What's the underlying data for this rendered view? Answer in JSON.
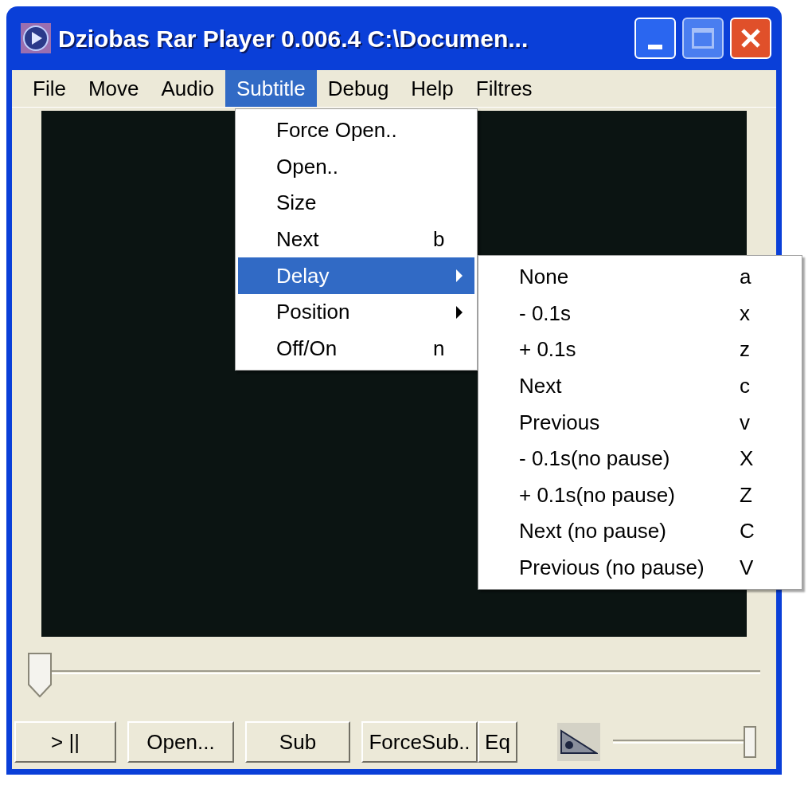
{
  "window": {
    "title": "Dziobas Rar Player 0.006.4 C:\\Documen..."
  },
  "menu_bar": [
    {
      "label": "File",
      "selected": false
    },
    {
      "label": "Move",
      "selected": false
    },
    {
      "label": "Audio",
      "selected": false
    },
    {
      "label": "Subtitle",
      "selected": true
    },
    {
      "label": "Debug",
      "selected": false
    },
    {
      "label": "Help",
      "selected": false
    },
    {
      "label": "Filtres",
      "selected": false
    }
  ],
  "subtitle_menu": [
    {
      "label": "Force Open..",
      "submenu": false,
      "selected": false
    },
    {
      "label": "Open..",
      "submenu": false,
      "selected": false
    },
    {
      "label": "Size",
      "submenu": false,
      "selected": false
    },
    {
      "label": "Next",
      "shortcut": "b",
      "submenu": false,
      "selected": false
    },
    {
      "label": "Delay",
      "submenu": true,
      "selected": true
    },
    {
      "label": "Position",
      "submenu": true,
      "selected": false
    },
    {
      "label": "Off/On",
      "shortcut": "n",
      "submenu": false,
      "selected": false
    }
  ],
  "delay_submenu": [
    {
      "label": "None",
      "shortcut": "a",
      "selected": false
    },
    {
      "label": "- 0.1s",
      "shortcut": "x",
      "selected": false
    },
    {
      "label": "+ 0.1s",
      "shortcut": "z",
      "selected": false
    },
    {
      "label": "Next",
      "shortcut": "c",
      "selected": false
    },
    {
      "label": "Previous",
      "shortcut": "v",
      "selected": false
    },
    {
      "label": "- 0.1s(no pause)",
      "shortcut": "X",
      "selected": false
    },
    {
      "label": "+ 0.1s(no pause)",
      "shortcut": "Z",
      "selected": false
    },
    {
      "label": "Next (no pause)",
      "shortcut": "C",
      "selected": false
    },
    {
      "label": "Previous (no pause)",
      "shortcut": "V",
      "selected": false
    }
  ],
  "seek_slider": {
    "level": 0
  },
  "buttons": [
    {
      "label": "> ||"
    },
    {
      "label": "Open..."
    },
    {
      "label": "Sub"
    },
    {
      "label": "ForceSub.."
    },
    {
      "label": "Eq"
    }
  ],
  "volume_slider": {
    "level": 1
  }
}
